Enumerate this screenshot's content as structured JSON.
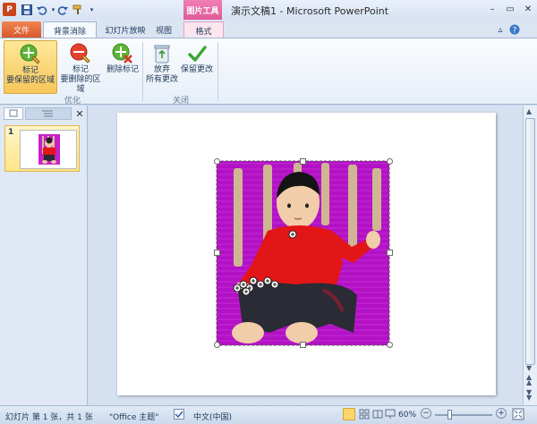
{
  "titlebar": {
    "title": "演示文稿1 - Microsoft PowerPoint",
    "context_tab": "图片工具"
  },
  "tabs": {
    "file": "文件",
    "background_removal": "背景消除",
    "slideshow": "幻灯片放映",
    "view": "视图",
    "format": "格式"
  },
  "ribbon": {
    "keep_line1": "标记",
    "keep_line2": "要保留的区域",
    "remove_line1": "标记",
    "remove_line2": "要删除的区域",
    "delete_mark": "删除标记",
    "discard_line1": "放弃",
    "discard_line2": "所有更改",
    "keep_changes": "保留更改",
    "group_refine": "优化",
    "group_close": "关闭"
  },
  "slides_pane": {
    "slide_number": "1"
  },
  "status": {
    "slide_info": "幻灯片 第 1 张，共 1 张",
    "theme": "\"Office 主题\"",
    "language": "中文(中国)",
    "zoom": "60%"
  },
  "colors": {
    "accent_file": "#d9582b",
    "picture_tools": "#e15a9a",
    "magenta_mask": "#b012c4"
  }
}
